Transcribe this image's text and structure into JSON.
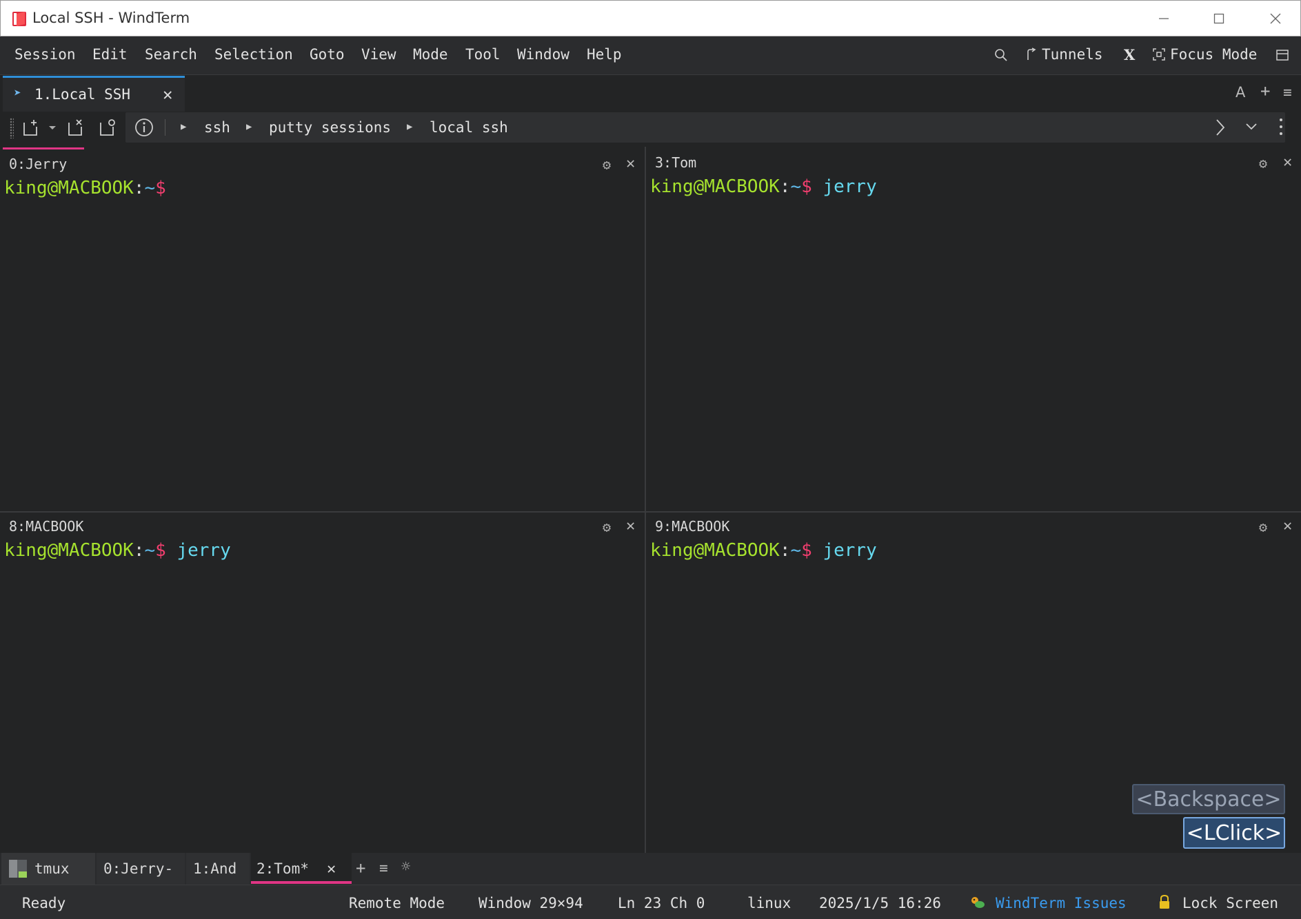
{
  "window": {
    "title": "Local SSH - WindTerm"
  },
  "menu": [
    "Session",
    "Edit",
    "Search",
    "Selection",
    "Goto",
    "View",
    "Mode",
    "Tool",
    "Window",
    "Help"
  ],
  "menu_right": {
    "tunnels": "Tunnels",
    "x_label": "X",
    "focus_mode": "Focus Mode"
  },
  "session_tab": {
    "label": "1.Local SSH",
    "close": "✕"
  },
  "strip_right": {
    "font": "A",
    "add": "+",
    "menu": "≡"
  },
  "breadcrumb": [
    "ssh",
    "putty sessions",
    "local ssh"
  ],
  "panes": [
    {
      "title": "0:Jerry",
      "user": "king@MACBOOK",
      "sep": ":",
      "path": "~",
      "dollar": "$",
      "command": ""
    },
    {
      "title": "3:Tom",
      "user": "king@MACBOOK",
      "sep": ":",
      "path": "~",
      "dollar": "$",
      "command": " jerry"
    },
    {
      "title": "8:MACBOOK",
      "user": "king@MACBOOK",
      "sep": ":",
      "path": "~",
      "dollar": "$",
      "command": " jerry"
    },
    {
      "title": "9:MACBOOK",
      "user": "king@MACBOOK",
      "sep": ":",
      "path": "~",
      "dollar": "$",
      "command": " jerry"
    }
  ],
  "key_overlays": {
    "backspace": "<Backspace>",
    "lclick": "<LClick>"
  },
  "tmux": {
    "label": "tmux",
    "windows": [
      "0:Jerry-",
      "1:And",
      "2:Tom*"
    ],
    "close": "✕",
    "add": "+",
    "menu": "≡",
    "settings": "☼"
  },
  "status": {
    "ready": "Ready",
    "remote_mode": "Remote Mode",
    "window_size": "Window 29×94",
    "cursor": "Ln 23 Ch 0",
    "os": "linux",
    "datetime": "2025/1/5 16:26",
    "issues": "WindTerm Issues",
    "lock": "Lock Screen"
  },
  "colors": {
    "accent_blue": "#2f8fd8",
    "accent_pink": "#e03585",
    "prompt_user": "#a6e22e",
    "prompt_dollar": "#f03e6e",
    "command": "#66d9ef"
  }
}
